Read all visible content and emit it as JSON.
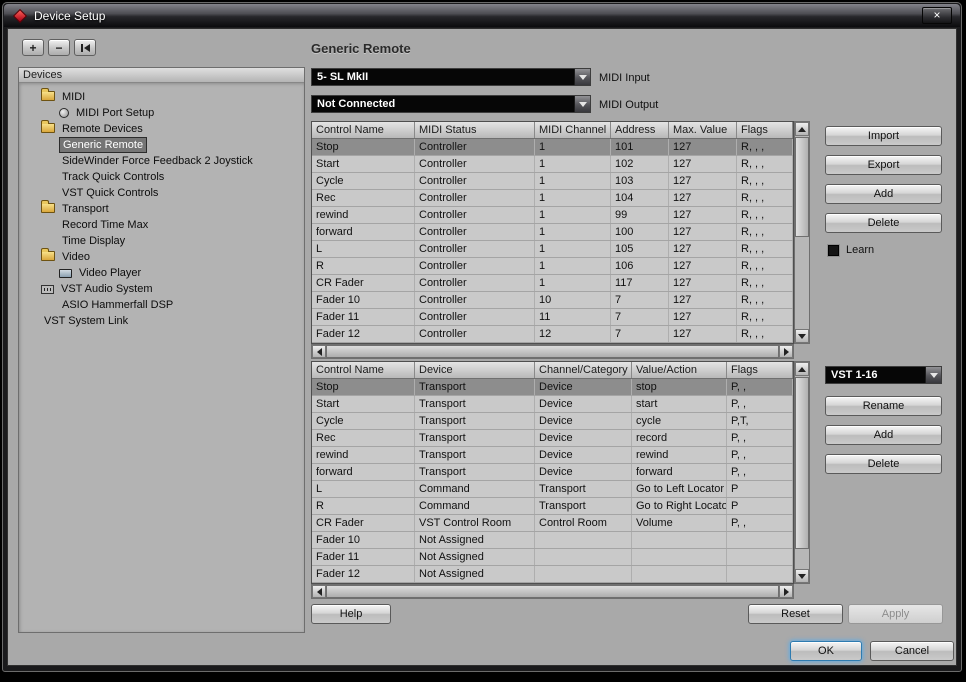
{
  "window": {
    "title": "Device Setup",
    "close_glyph": "x"
  },
  "left": {
    "toolbar": {
      "add": "+",
      "remove": "−"
    },
    "header": "Devices",
    "tree": [
      {
        "label": "MIDI",
        "indent": 1,
        "icon": "folder"
      },
      {
        "label": "MIDI Port Setup",
        "indent": 2,
        "icon": "midi-port"
      },
      {
        "label": "Remote Devices",
        "indent": 1,
        "icon": "folder"
      },
      {
        "label": "Generic Remote",
        "indent": 2,
        "selected": true
      },
      {
        "label": "SideWinder Force Feedback 2 Joystick",
        "indent": 2
      },
      {
        "label": "Track Quick Controls",
        "indent": 2
      },
      {
        "label": "VST Quick Controls",
        "indent": 2
      },
      {
        "label": "Transport",
        "indent": 1,
        "icon": "folder"
      },
      {
        "label": "Record Time Max",
        "indent": 2
      },
      {
        "label": "Time Display",
        "indent": 2
      },
      {
        "label": "Video",
        "indent": 1,
        "icon": "folder"
      },
      {
        "label": "Video Player",
        "indent": 2,
        "icon": "video-player"
      },
      {
        "label": "VST Audio System",
        "indent": 1,
        "icon": "audio-system"
      },
      {
        "label": "ASIO Hammerfall DSP",
        "indent": 2
      },
      {
        "label": "VST System Link",
        "indent": 1
      }
    ]
  },
  "main": {
    "title": "Generic Remote",
    "midi_input": {
      "label": "MIDI Input",
      "value": "5- SL MkII"
    },
    "midi_output": {
      "label": "MIDI Output",
      "value": "Not Connected"
    },
    "bank_select": {
      "value": "VST 1-16"
    },
    "upper_table": {
      "columns": [
        "Control Name",
        "MIDI Status",
        "MIDI Channel",
        "Address",
        "Max. Value",
        "Flags"
      ],
      "selected_row": 0,
      "rows": [
        [
          "Stop",
          "Controller",
          "1",
          "101",
          "127",
          "R, , ,"
        ],
        [
          "Start",
          "Controller",
          "1",
          "102",
          "127",
          "R, , ,"
        ],
        [
          "Cycle",
          "Controller",
          "1",
          "103",
          "127",
          "R, , ,"
        ],
        [
          "Rec",
          "Controller",
          "1",
          "104",
          "127",
          "R, , ,"
        ],
        [
          "rewind",
          "Controller",
          "1",
          "99",
          "127",
          "R, , ,"
        ],
        [
          "forward",
          "Controller",
          "1",
          "100",
          "127",
          "R, , ,"
        ],
        [
          "L",
          "Controller",
          "1",
          "105",
          "127",
          "R, , ,"
        ],
        [
          "R",
          "Controller",
          "1",
          "106",
          "127",
          "R, , ,"
        ],
        [
          "CR Fader",
          "Controller",
          "1",
          "117",
          "127",
          "R, , ,"
        ],
        [
          "Fader 10",
          "Controller",
          "10",
          "7",
          "127",
          "R, , ,"
        ],
        [
          "Fader 11",
          "Controller",
          "11",
          "7",
          "127",
          "R, , ,"
        ],
        [
          "Fader 12",
          "Controller",
          "12",
          "7",
          "127",
          "R, , ,"
        ]
      ]
    },
    "lower_table": {
      "columns": [
        "Control Name",
        "Device",
        "Channel/Category",
        "Value/Action",
        "Flags"
      ],
      "selected_row": 0,
      "rows": [
        [
          "Stop",
          "Transport",
          "Device",
          "stop",
          "P, ,"
        ],
        [
          "Start",
          "Transport",
          "Device",
          "start",
          "P, ,"
        ],
        [
          "Cycle",
          "Transport",
          "Device",
          "cycle",
          "P,T,"
        ],
        [
          "Rec",
          "Transport",
          "Device",
          "record",
          "P, ,"
        ],
        [
          "rewind",
          "Transport",
          "Device",
          "rewind",
          "P, ,"
        ],
        [
          "forward",
          "Transport",
          "Device",
          "forward",
          "P, ,"
        ],
        [
          "L",
          "Command",
          "Transport",
          "Go to Left Locator",
          "P"
        ],
        [
          "R",
          "Command",
          "Transport",
          "Go to Right Locator",
          "P"
        ],
        [
          "CR Fader",
          "VST Control Room",
          "Control Room",
          "Volume",
          "P, ,"
        ],
        [
          "Fader 10",
          "Not Assigned",
          "",
          "",
          ""
        ],
        [
          "Fader 11",
          "Not Assigned",
          "",
          "",
          ""
        ],
        [
          "Fader 12",
          "Not Assigned",
          "",
          "",
          ""
        ]
      ]
    },
    "buttons": {
      "import": "Import",
      "export": "Export",
      "add_upper": "Add",
      "delete_upper": "Delete",
      "learn": "Learn",
      "rename": "Rename",
      "add_lower": "Add",
      "delete_lower": "Delete",
      "help": "Help",
      "reset": "Reset",
      "apply": "Apply",
      "ok": "OK",
      "cancel": "Cancel"
    }
  },
  "colors": {
    "accent_red": "#c01020",
    "selection_gray": "#8d8d8d",
    "combo_bg": "#060606"
  }
}
